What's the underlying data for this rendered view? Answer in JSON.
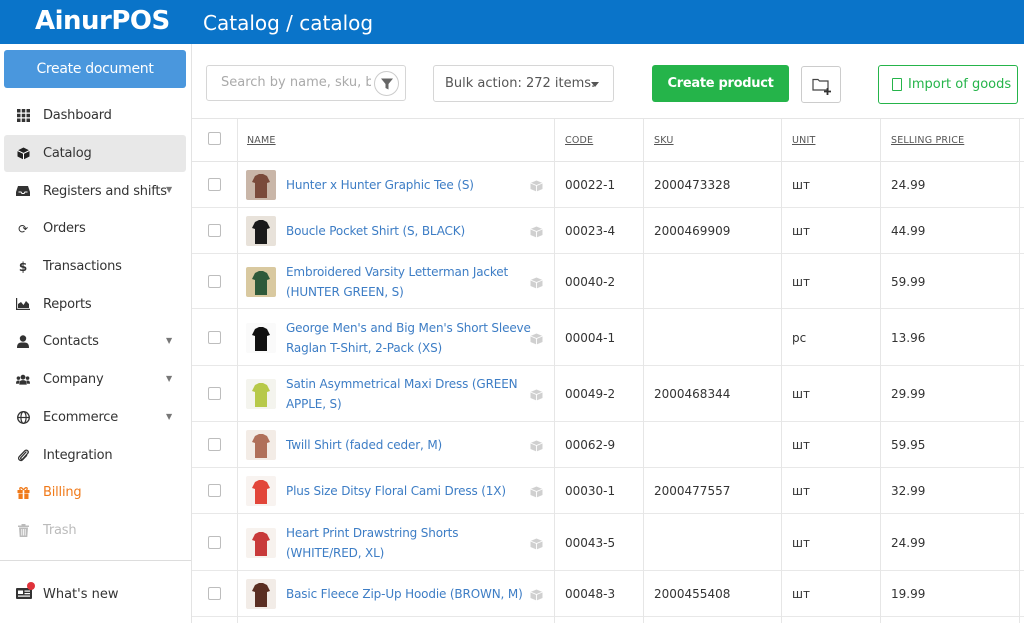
{
  "app": {
    "brand": "AinurPOS",
    "breadcrumb": "Catalog / catalog"
  },
  "sidebar": {
    "create_document": "Create document",
    "items": [
      {
        "label": "Dashboard",
        "icon": "grid-icon",
        "chevron": false
      },
      {
        "label": "Catalog",
        "icon": "cube-icon",
        "chevron": false
      },
      {
        "label": "Registers and shifts",
        "icon": "inbox-icon",
        "chevron": true
      },
      {
        "label": "Orders",
        "icon": "refresh-icon",
        "chevron": false
      },
      {
        "label": "Transactions",
        "icon": "dollar-icon",
        "chevron": false
      },
      {
        "label": "Reports",
        "icon": "chart-icon",
        "chevron": false
      },
      {
        "label": "Contacts",
        "icon": "user-icon",
        "chevron": true
      },
      {
        "label": "Company",
        "icon": "users-icon",
        "chevron": true
      },
      {
        "label": "Ecommerce",
        "icon": "globe-icon",
        "chevron": true
      },
      {
        "label": "Integration",
        "icon": "paperclip-icon",
        "chevron": false
      },
      {
        "label": "Billing",
        "icon": "gift-icon",
        "chevron": false
      },
      {
        "label": "Trash",
        "icon": "trash-icon",
        "chevron": false
      }
    ],
    "whats_new": "What's new"
  },
  "toolbar": {
    "search_placeholder": "Search by name, sku, barcode",
    "bulk_action": "Bulk action: 272 items.",
    "create_product": "Create product",
    "import_goods": "Import of goods"
  },
  "table": {
    "headers": {
      "name": "NAME",
      "code": "CODE",
      "sku": "SKU",
      "unit": "UNIT",
      "price": "SELLING PRICE"
    },
    "rows": [
      {
        "name": "Hunter x Hunter Graphic Tee (S)",
        "code": "00022-1",
        "sku": "2000473328",
        "unit": "шт",
        "price": "24.99"
      },
      {
        "name": "Boucle Pocket Shirt (S, BLACK)",
        "code": "00023-4",
        "sku": "2000469909",
        "unit": "шт",
        "price": "44.99"
      },
      {
        "name": "Embroidered Varsity Letterman Jacket (HUNTER GREEN, S)",
        "code": "00040-2",
        "sku": "",
        "unit": "шт",
        "price": "59.99"
      },
      {
        "name": "George Men's and Big Men's Short Sleeve Raglan T-Shirt, 2-Pack (XS)",
        "code": "00004-1",
        "sku": "",
        "unit": "pc",
        "price": "13.96"
      },
      {
        "name": "Satin Asymmetrical Maxi Dress (GREEN APPLE, S)",
        "code": "00049-2",
        "sku": "2000468344",
        "unit": "шт",
        "price": "29.99"
      },
      {
        "name": "Twill Shirt (faded ceder, M)",
        "code": "00062-9",
        "sku": "",
        "unit": "шт",
        "price": "59.95"
      },
      {
        "name": "Plus Size Ditsy Floral Cami Dress (1X)",
        "code": "00030-1",
        "sku": "2000477557",
        "unit": "шт",
        "price": "32.99"
      },
      {
        "name": "Heart Print Drawstring Shorts (WHITE/RED, XL)",
        "code": "00043-5",
        "sku": "",
        "unit": "шт",
        "price": "24.99"
      },
      {
        "name": "Basic Fleece Zip-Up Hoodie (BROWN, M)",
        "code": "00048-3",
        "sku": "2000455408",
        "unit": "шт",
        "price": "19.99"
      }
    ]
  },
  "colors": {
    "header": "#0a74c9",
    "primary": "#4a97dd",
    "success": "#25b44a",
    "link": "#3d7dc5",
    "billing": "#f07a1a"
  }
}
